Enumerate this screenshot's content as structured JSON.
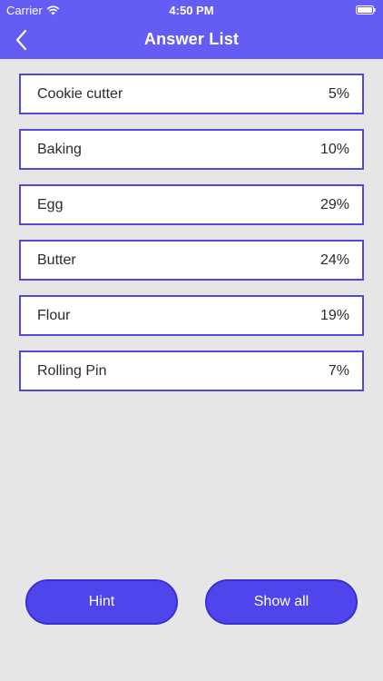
{
  "status_bar": {
    "carrier": "Carrier",
    "time": "4:50 PM"
  },
  "nav": {
    "title": "Answer List",
    "back_icon": "chevron-left-icon"
  },
  "answers": [
    {
      "label": "Cookie cutter",
      "percent": "5%"
    },
    {
      "label": "Baking",
      "percent": "10%"
    },
    {
      "label": "Egg",
      "percent": "29%"
    },
    {
      "label": "Butter",
      "percent": "24%"
    },
    {
      "label": "Flour",
      "percent": "19%"
    },
    {
      "label": "Rolling Pin",
      "percent": "7%"
    }
  ],
  "buttons": {
    "hint": "Hint",
    "show_all": "Show all"
  },
  "colors": {
    "accent": "#645cf3",
    "button": "#5044ec",
    "row_border": "#5048d8",
    "background": "#e6e6e6"
  }
}
